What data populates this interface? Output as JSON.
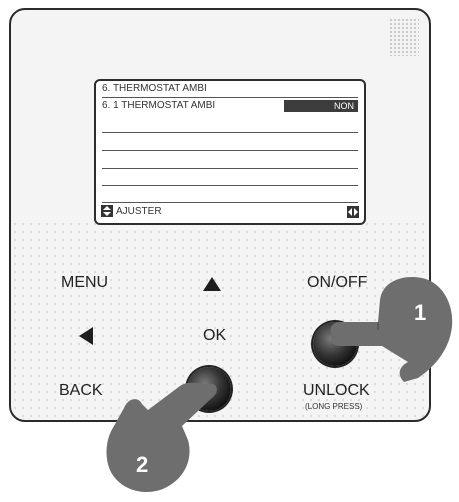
{
  "screen": {
    "title": "6.  THERMOSTAT AMBI",
    "item_label": "6. 1 THERMOSTAT AMBI",
    "item_value": "NON",
    "footer_label": "AJUSTER",
    "up_down_icon": "up-down-arrows-icon",
    "left_right_icon": "left-right-arrows-icon"
  },
  "buttons": {
    "menu": "MENU",
    "up_icon": "up-triangle-icon",
    "onoff": "ON/OFF",
    "left_icon": "left-triangle-icon",
    "ok": "OK",
    "back": "BACK",
    "unlock": "UNLOCK",
    "unlock_sub": "(LONG PRESS)"
  },
  "callouts": {
    "hand1_number": "1",
    "hand2_number": "2"
  },
  "colors": {
    "hand": "#6e6e6e",
    "lcd_highlight": "#3c3c3c"
  }
}
